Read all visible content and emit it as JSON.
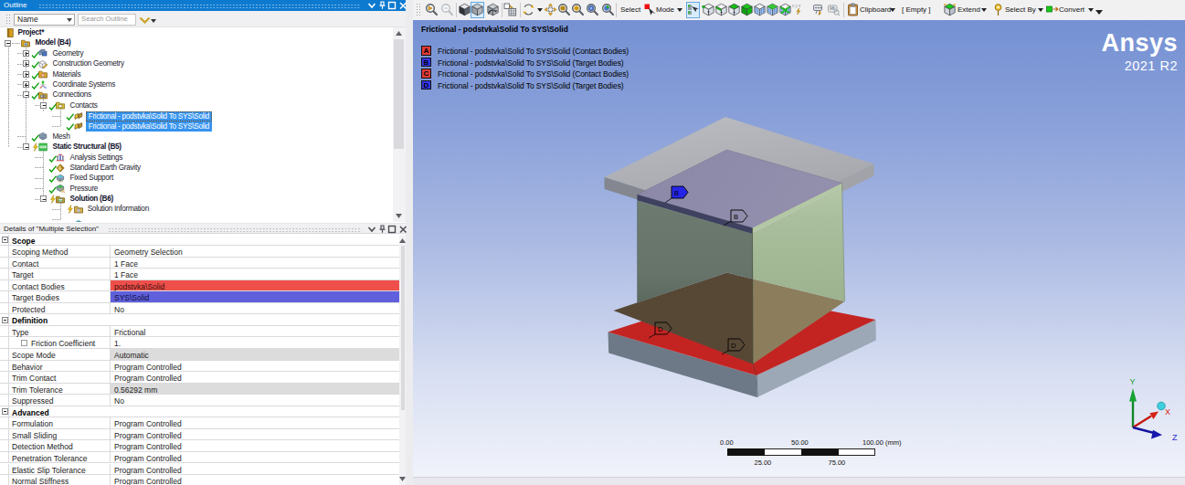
{
  "outline": {
    "title": "Outline",
    "filter_label": "Name",
    "search_placeholder": "Search Outline",
    "tree": [
      {
        "label": "Project*",
        "icon": "project",
        "level": 0,
        "bold": true
      },
      {
        "label": "Model (B4)",
        "icon": "model",
        "level": 1,
        "bold": true,
        "expand": "minus"
      },
      {
        "label": "Geometry",
        "icon": "geometry",
        "level": 2,
        "expand": "plus",
        "check": true
      },
      {
        "label": "Construction Geometry",
        "icon": "construction-geometry",
        "level": 2,
        "expand": "plus",
        "check": true
      },
      {
        "label": "Materials",
        "icon": "materials",
        "level": 2,
        "expand": "plus",
        "check": true
      },
      {
        "label": "Coordinate Systems",
        "icon": "coordinate-systems",
        "level": 2,
        "expand": "plus",
        "check": true
      },
      {
        "label": "Connections",
        "icon": "connections",
        "level": 2,
        "expand": "minus",
        "check": true
      },
      {
        "label": "Contacts",
        "icon": "contacts",
        "level": 3,
        "expand": "minus",
        "check": true
      },
      {
        "label": "Frictional - podstvka\\Solid To SYS\\Solid",
        "icon": "contact-pair",
        "level": 4,
        "check": true,
        "selected": true,
        "focus": true
      },
      {
        "label": "Frictional - podstvka\\Solid To SYS\\Solid",
        "icon": "contact-pair",
        "level": 4,
        "check": true,
        "selected": true
      },
      {
        "label": "Mesh",
        "icon": "mesh",
        "level": 2,
        "check": true
      },
      {
        "label": "Static Structural (B5)",
        "icon": "static-structural",
        "level": 2,
        "bold": true,
        "expand": "minus",
        "lightning": true
      },
      {
        "label": "Analysis Settings",
        "icon": "analysis-settings",
        "level": 3,
        "check": true
      },
      {
        "label": "Standard Earth Gravity",
        "icon": "earth-gravity",
        "level": 3,
        "check": true
      },
      {
        "label": "Fixed Support",
        "icon": "fixed-support",
        "level": 3,
        "check": true
      },
      {
        "label": "Pressure",
        "icon": "pressure",
        "level": 3,
        "check": true
      },
      {
        "label": "Solution (B6)",
        "icon": "solution",
        "level": 3,
        "bold": true,
        "expand": "minus",
        "lightning": true
      },
      {
        "label": "Solution Information",
        "icon": "solution-information",
        "level": 4,
        "lightning": true
      },
      {
        "label": "",
        "icon": "result-partial",
        "level": 4,
        "partial": true
      }
    ]
  },
  "details": {
    "title": "Details of \"Multiple Selection\"",
    "rows": [
      {
        "type": "section",
        "label": "Scope"
      },
      {
        "label": "Scoping Method",
        "value": "Geometry Selection"
      },
      {
        "label": "Contact",
        "value": "1 Face"
      },
      {
        "label": "Target",
        "value": "1 Face"
      },
      {
        "label": "Contact Bodies",
        "value": "podstvka\\Solid",
        "style": "contact"
      },
      {
        "label": "Target Bodies",
        "value": "SYS\\Solid",
        "style": "target"
      },
      {
        "label": "Protected",
        "value": "No"
      },
      {
        "type": "section",
        "label": "Definition"
      },
      {
        "label": "Type",
        "value": "Frictional"
      },
      {
        "label": "Friction Coefficient",
        "value": "1.",
        "checkbox": true
      },
      {
        "label": "Scope Mode",
        "value": "Automatic",
        "style": "readonly"
      },
      {
        "label": "Behavior",
        "value": "Program Controlled"
      },
      {
        "label": "Trim Contact",
        "value": "Program Controlled"
      },
      {
        "label": "Trim Tolerance",
        "value": "0.56292 mm",
        "style": "readonly"
      },
      {
        "label": "Suppressed",
        "value": "No"
      },
      {
        "type": "section",
        "label": "Advanced"
      },
      {
        "label": "Formulation",
        "value": "Program Controlled"
      },
      {
        "label": "Small Sliding",
        "value": "Program Controlled"
      },
      {
        "label": "Detection Method",
        "value": "Program Controlled"
      },
      {
        "label": "Penetration Tolerance",
        "value": "Program Controlled"
      },
      {
        "label": "Elastic Slip Tolerance",
        "value": "Program Controlled"
      },
      {
        "label": "Normal Stiffness",
        "value": "Program Controlled"
      }
    ]
  },
  "toolbar": {
    "select_label": "Select",
    "mode_label": "Mode",
    "clipboard_label": "Clipboard",
    "empty_label": "[ Empty ]",
    "extend_label": "Extend",
    "select_by_label": "Select By",
    "convert_label": "Convert"
  },
  "viewport": {
    "legend_title": "Frictional - podstvka\\Solid To SYS\\Solid",
    "legend_items": [
      {
        "key": "A",
        "color": "#e03a36",
        "label": "Frictional - podstvka\\Solid To SYS\\Solid (Contact Bodies)"
      },
      {
        "key": "B",
        "color": "#3434ee",
        "label": "Frictional - podstvka\\Solid To SYS\\Solid (Target Bodies)"
      },
      {
        "key": "C",
        "color": "#e03a36",
        "label": "Frictional - podstvka\\Solid To SYS\\Solid (Contact Bodies)"
      },
      {
        "key": "D",
        "color": "#3434ee",
        "label": "Frictional - podstvka\\Solid To SYS\\Solid (Target Bodies)"
      }
    ],
    "logo_line1": "Ansys",
    "logo_line2": "2021 R2",
    "ruler": {
      "top_labels": [
        "0.00",
        "50.00",
        "100.00 (mm)"
      ],
      "bottom_labels": [
        "25.00",
        "75.00"
      ]
    },
    "triad": {
      "x": "X",
      "y": "Y",
      "z": "Z"
    },
    "flags": [
      {
        "label": "B",
        "type": "target"
      },
      {
        "label": "B",
        "type": "outline"
      },
      {
        "label": "D",
        "type": "outline"
      },
      {
        "label": "D",
        "type": "outline"
      }
    ]
  }
}
